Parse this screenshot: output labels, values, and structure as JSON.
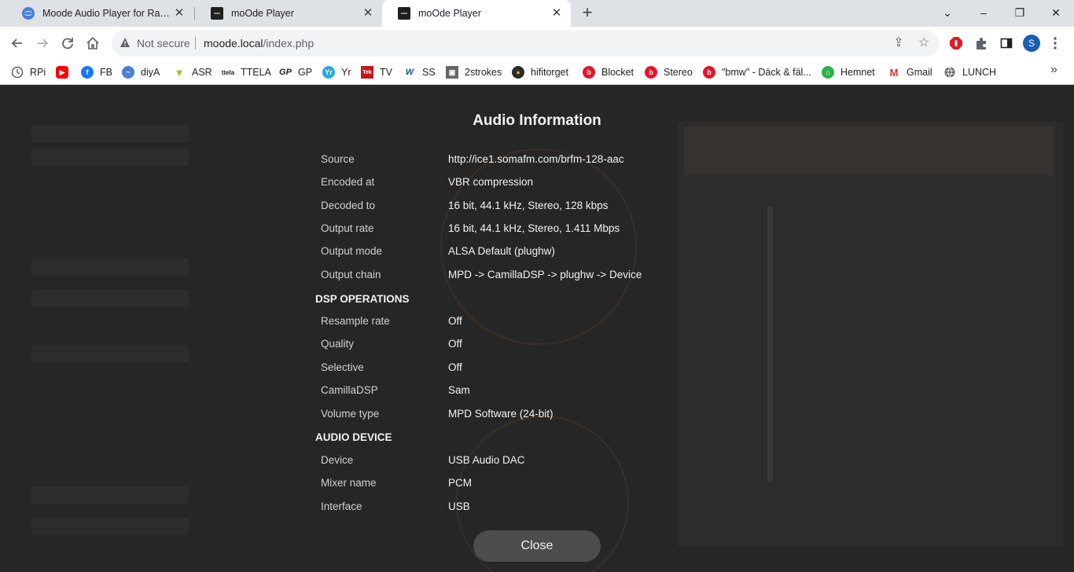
{
  "browser": {
    "tabs": [
      {
        "title": "Moode Audio Player for Raspber",
        "active": false,
        "icon": "moode-wave-icon"
      },
      {
        "title": "moOde Player",
        "active": false,
        "icon": "moode-logo-icon"
      },
      {
        "title": "moOde Player",
        "active": true,
        "icon": "moode-logo-icon"
      }
    ],
    "new_tab": "+",
    "window_controls": {
      "dropdown": "⌄",
      "minimize": "–",
      "restore": "❐",
      "close": "✕"
    }
  },
  "toolbar": {
    "security_label": "Not secure",
    "url_host": "moode.local",
    "url_path": "/index.php",
    "avatar_letter": "S"
  },
  "bookmarks": [
    {
      "label": "RPi",
      "icon": "clock-icon",
      "color": "#5f6368"
    },
    {
      "label": "",
      "icon": "youtube-icon",
      "color": "#ff0000"
    },
    {
      "label": "FB",
      "icon": "facebook-icon",
      "color": "#1877f2"
    },
    {
      "label": "diyA",
      "icon": "diya-icon",
      "color": "#4a7fd4"
    },
    {
      "label": "ASR",
      "icon": "asr-icon",
      "color": "#a8b82a"
    },
    {
      "label": "TTELA",
      "icon": "ttela-icon",
      "color": "#222222"
    },
    {
      "label": "GP",
      "icon": "gp-icon",
      "color": "#222222"
    },
    {
      "label": "Yr",
      "icon": "yr-icon",
      "color": "#2aa8e0"
    },
    {
      "label": "TV",
      "icon": "tek-icon",
      "color": "#c4161c"
    },
    {
      "label": "SS",
      "icon": "wf-icon",
      "color": "#1b4f9c"
    },
    {
      "label": "2strokes",
      "icon": "2strokes-icon",
      "color": "#666666"
    },
    {
      "label": "hifitorget",
      "icon": "hifitorget-icon",
      "color": "#2b2b2b"
    },
    {
      "label": "Blocket",
      "icon": "blocket-icon",
      "color": "#e3152b"
    },
    {
      "label": "Stereo",
      "icon": "blocket-icon",
      "color": "#e3152b"
    },
    {
      "label": "\"bmw\" - Däck & fäl...",
      "icon": "blocket-icon",
      "color": "#e3152b"
    },
    {
      "label": "Hemnet",
      "icon": "hemnet-icon",
      "color": "#2fb24c"
    },
    {
      "label": "Gmail",
      "icon": "gmail-icon",
      "color": "#d93025"
    },
    {
      "label": "LUNCH",
      "icon": "globe-icon",
      "color": "#5f6368"
    }
  ],
  "modal": {
    "title": "Audio Information",
    "rows_general": [
      {
        "label": "Source",
        "value": "http://ice1.somafm.com/brfm-128-aac"
      },
      {
        "label": "Encoded at",
        "value": "VBR compression"
      },
      {
        "label": "Decoded to",
        "value": "16 bit, 44.1 kHz, Stereo, 128 kbps"
      },
      {
        "label": "Output rate",
        "value": "16 bit, 44.1 kHz, Stereo, 1.411 Mbps"
      },
      {
        "label": "Output mode",
        "value": "ALSA Default (plughw)"
      },
      {
        "label": "Output chain",
        "value": "MPD -> CamillaDSP -> plughw -> Device"
      }
    ],
    "section_dsp": "DSP OPERATIONS",
    "rows_dsp": [
      {
        "label": "Resample rate",
        "value": "Off"
      },
      {
        "label": "Quality",
        "value": "Off"
      },
      {
        "label": "Selective",
        "value": "Off"
      },
      {
        "label": "CamillaDSP",
        "value": "Sam"
      },
      {
        "label": "Volume type",
        "value": "MPD Software (24-bit)"
      }
    ],
    "section_device": "AUDIO DEVICE",
    "rows_device": [
      {
        "label": "Device",
        "value": "USB Audio DAC"
      },
      {
        "label": "Mixer name",
        "value": "PCM"
      },
      {
        "label": "Interface",
        "value": "USB"
      }
    ],
    "close_label": "Close"
  }
}
